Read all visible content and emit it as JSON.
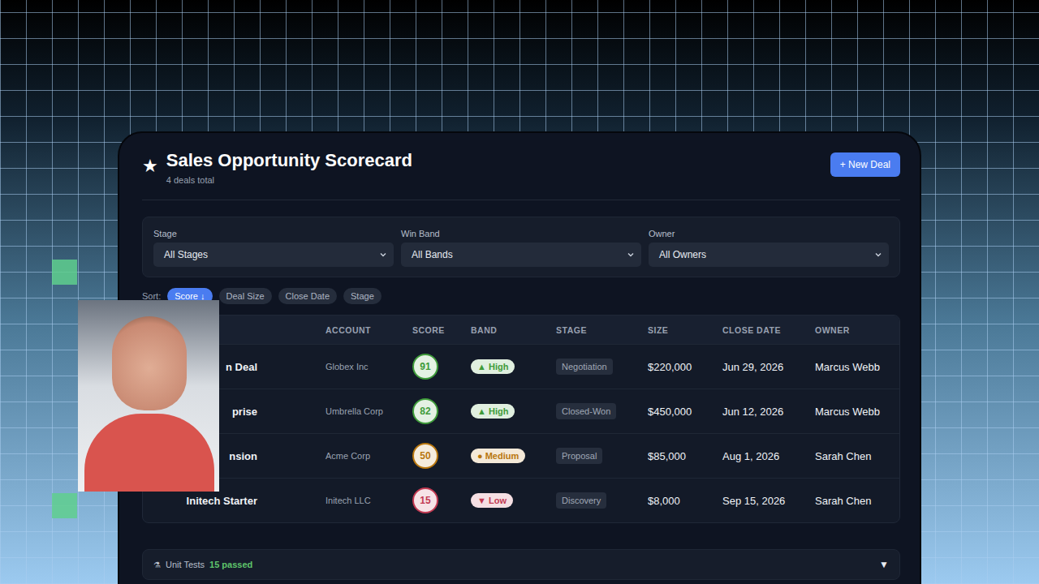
{
  "window": {
    "title": "Sales Opportunity Scorecard",
    "subtitle": "4 deals total",
    "icon": "★"
  },
  "new_deal_button": "+ New Deal",
  "filters": [
    {
      "label": "Stage",
      "value": "All Stages"
    },
    {
      "label": "Win Band",
      "value": "All Bands"
    },
    {
      "label": "Owner",
      "value": "All Owners"
    }
  ],
  "sort": {
    "label": "Sort:",
    "options": [
      {
        "label": "Score ↓",
        "selected": true
      },
      {
        "label": "Deal Size",
        "selected": false
      },
      {
        "label": "Close Date",
        "selected": false
      },
      {
        "label": "Stage",
        "selected": false
      }
    ]
  },
  "table": {
    "columns": [
      "",
      "ACCOUNT",
      "SCORE",
      "BAND",
      "STAGE",
      "SIZE",
      "CLOSE DATE",
      "OWNER"
    ],
    "rows": [
      {
        "deal": "n Deal",
        "account": "Globex Inc",
        "score": "91",
        "band": "▲ High",
        "color": "#3f9b3a",
        "stage": "Negotiation",
        "size": "$220,000",
        "close": "Jun 29, 2026",
        "owner": "Marcus Webb"
      },
      {
        "deal": "prise",
        "account": "Umbrella Corp",
        "score": "82",
        "band": "▲ High",
        "color": "#3f9b3a",
        "stage": "Closed-Won",
        "size": "$450,000",
        "close": "Jun 12, 2026",
        "owner": "Marcus Webb"
      },
      {
        "deal": "nsion",
        "account": "Acme Corp",
        "score": "50",
        "band": "● Medium",
        "color": "#b9770e",
        "stage": "Proposal",
        "size": "$85,000",
        "close": "Aug 1, 2026",
        "owner": "Sarah Chen"
      },
      {
        "deal": "Initech Starter",
        "account": "Initech LLC",
        "score": "15",
        "band": "▼ Low",
        "color": "#c23a52",
        "stage": "Discovery",
        "size": "$8,000",
        "close": "Sep 15, 2026",
        "owner": "Sarah Chen"
      }
    ]
  },
  "unit_tests": {
    "icon": "⚗",
    "label": "Unit Tests",
    "result": "15 passed",
    "toggle": "▼"
  }
}
